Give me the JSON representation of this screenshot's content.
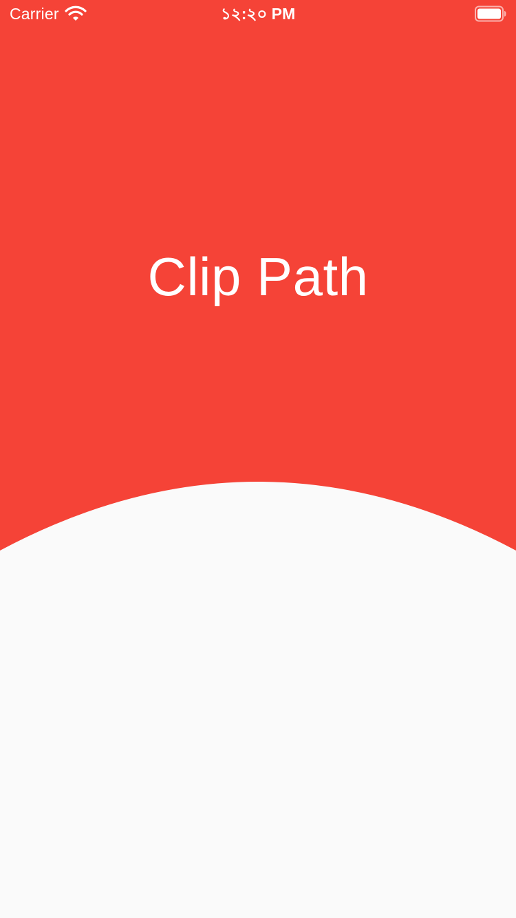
{
  "status_bar": {
    "carrier": "Carrier",
    "time": "১২:২০ PM",
    "wifi_icon": "wifi-icon",
    "battery_icon": "battery-icon"
  },
  "header": {
    "title": "Clip Path"
  },
  "colors": {
    "accent": "#f54337",
    "background": "#fafafa",
    "on_accent": "#ffffff"
  }
}
